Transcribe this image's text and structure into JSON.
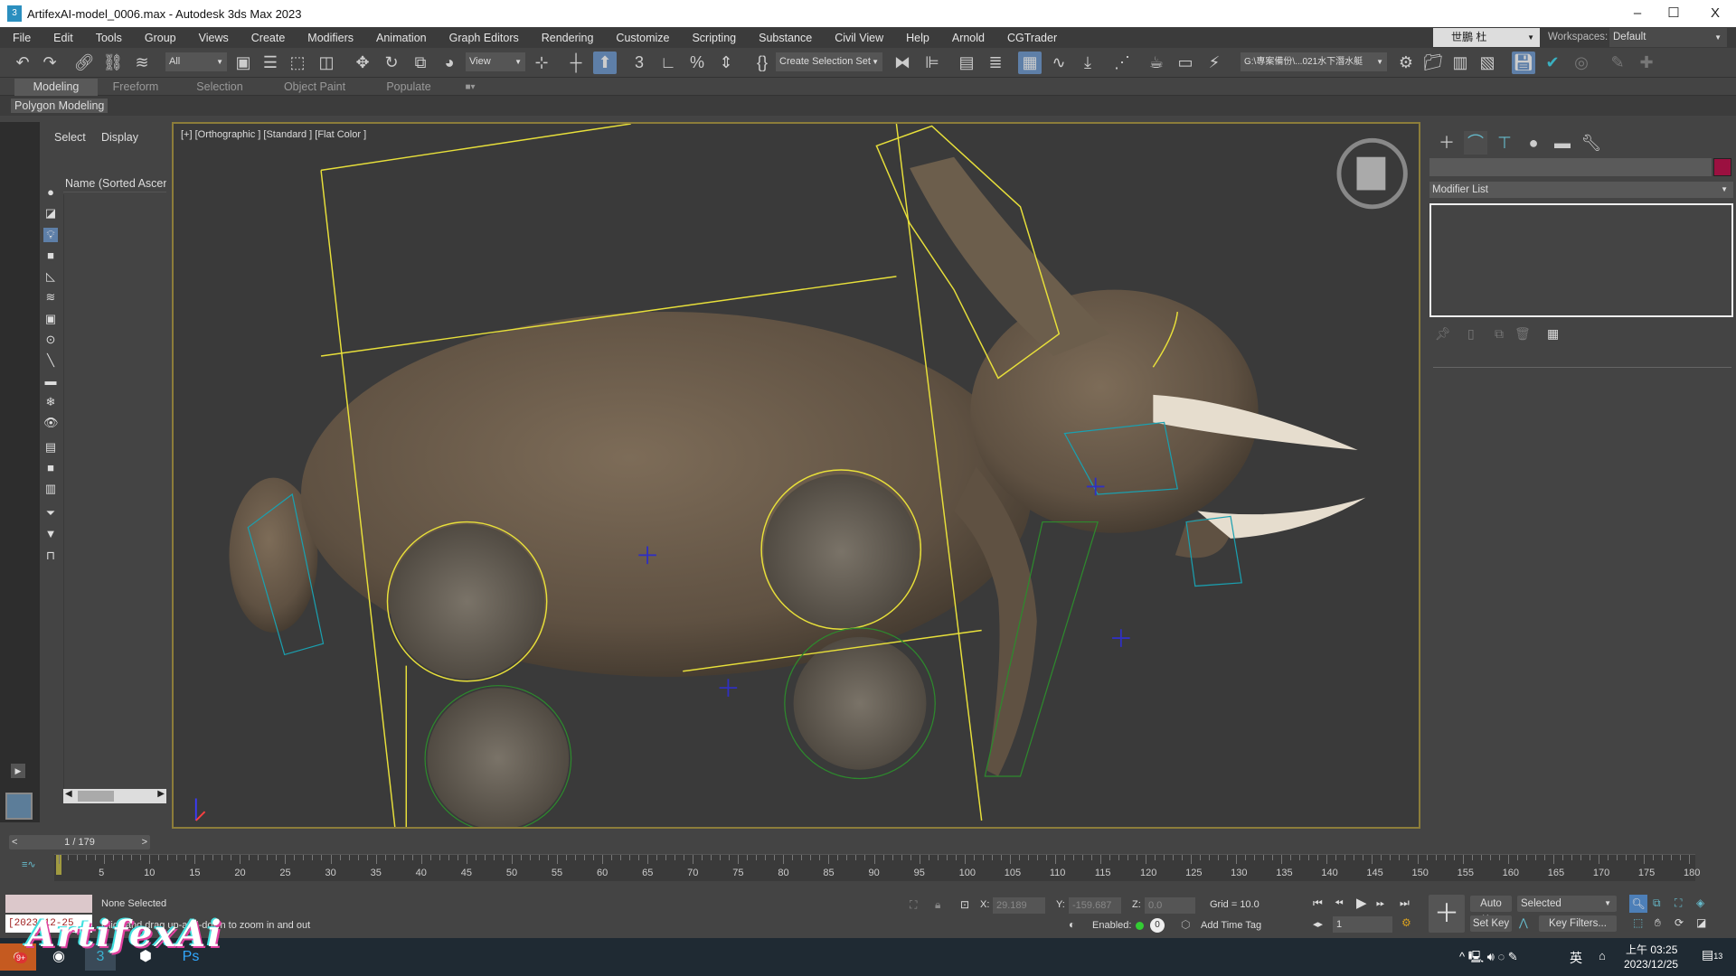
{
  "window": {
    "title": "ArtifexAI-model_0006.max - Autodesk 3ds Max 2023",
    "minimize": "–",
    "maximize": "☐",
    "close": "X"
  },
  "menu": [
    "File",
    "Edit",
    "Tools",
    "Group",
    "Views",
    "Create",
    "Modifiers",
    "Animation",
    "Graph Editors",
    "Rendering",
    "Customize",
    "Scripting",
    "Substance",
    "Civil View",
    "Help",
    "Arnold",
    "CGTrader"
  ],
  "user": {
    "name": "世鵬 杜",
    "workspaces_label": "Workspaces:",
    "workspace": "Default"
  },
  "toolbar": {
    "selection_filter": "All",
    "ref_coord": "View",
    "named_selection": "Create Selection Set",
    "project_path": "G:\\專案備份\\...021水下潛水艇"
  },
  "ribbon": {
    "tabs": [
      "Modeling",
      "Freeform",
      "Selection",
      "Object Paint",
      "Populate"
    ],
    "active": "Modeling",
    "subpanel": "Polygon Modeling"
  },
  "explorer": {
    "tabs": [
      "Select",
      "Display"
    ],
    "column_header": "Name (Sorted Ascending)"
  },
  "viewport": {
    "label": "[+] [Orthographic ] [Standard ] [Flat Color ]"
  },
  "command_panel": {
    "modifier_list": "Modifier List",
    "object_color": "#9b1040"
  },
  "timeline": {
    "frame": "1 / 179",
    "ticks": [
      5,
      10,
      15,
      20,
      25,
      30,
      35,
      40,
      45,
      50,
      55,
      60,
      65,
      70,
      75,
      80,
      85,
      90,
      95,
      100,
      105,
      110,
      115,
      120,
      125,
      130,
      135,
      140,
      145,
      150,
      155,
      160,
      165,
      170,
      175,
      180
    ]
  },
  "status": {
    "selection": "None Selected",
    "prompt": "Click and drag up-and-down to zoom in and out",
    "script_listener": "[2023-12-25",
    "x_label": "X:",
    "x": "29.189",
    "y_label": "Y:",
    "y": "-159.687",
    "z_label": "Z:",
    "z": "0.0",
    "grid": "Grid = 10.0",
    "enabled_label": "Enabled:",
    "add_time_tag": "Add Time Tag",
    "auto_key": "Auto Key",
    "set_key": "Set Key",
    "key_mode": "Selected",
    "key_filters": "Key Filters...",
    "current_frame": "1"
  },
  "taskbar": {
    "time": "上午 03:25",
    "date": "2023/12/25",
    "ime": "英",
    "notifications": "13",
    "badge": "9+"
  },
  "watermark": "ArtifexAi"
}
